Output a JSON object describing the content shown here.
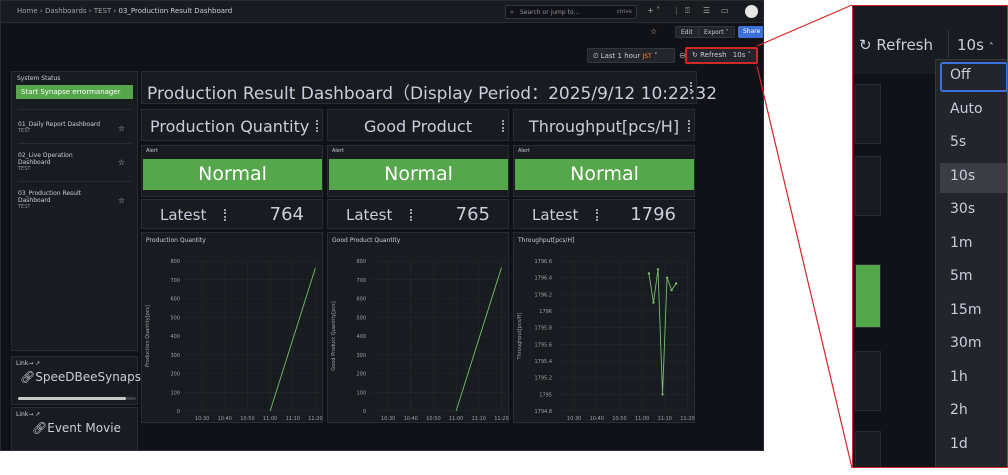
{
  "breadcrumb": {
    "home": "Home",
    "dashboards": "Dashboards",
    "folder": "TEST",
    "current": "03_Production Result Dashboard"
  },
  "search": {
    "placeholder": "Search or jump to...",
    "shortcut": "ctrl+k"
  },
  "toolbar": {
    "edit": "Edit",
    "export": "Export",
    "share": "Share"
  },
  "time_picker": {
    "label": "Last 1 hour",
    "tz": "JST"
  },
  "refresh": {
    "label": "Refresh",
    "interval": "10s"
  },
  "sidebar": {
    "title": "System Status",
    "button": "Start Synapse errormanager",
    "items": [
      {
        "name": "01_Daily Report Dashboard",
        "folder": "TEST"
      },
      {
        "name": "02_Live Operation Dashboard",
        "folder": "TEST"
      },
      {
        "name": "03_Production Result Dashboard",
        "folder": "TEST"
      }
    ]
  },
  "links": [
    {
      "title": "Link→",
      "label": "SpeeDBeeSynaps"
    },
    {
      "title": "Link→",
      "label": "Event Movie"
    }
  ],
  "main": {
    "title": "Production Result Dashboard（Display Period：2025/9/12 10:22:32",
    "columns": [
      {
        "header": "Production Quantity",
        "alert_title": "Alert",
        "alert": "Normal",
        "latest_label": "Latest",
        "latest": "764"
      },
      {
        "header": "Good Product",
        "alert_title": "Alert",
        "alert": "Normal",
        "latest_label": "Latest",
        "latest": "765"
      },
      {
        "header": "Throughput[pcs/H]",
        "alert_title": "Alert",
        "alert": "Normal",
        "latest_label": "Latest",
        "latest": "1796"
      }
    ]
  },
  "chart_data": [
    {
      "type": "line",
      "title": "Production Quantity",
      "ylabel": "Production Quantity[pcs]",
      "x": [
        "11:00",
        "11:20"
      ],
      "series": [
        {
          "values": [
            0,
            764
          ]
        }
      ],
      "ylim": [
        0,
        800
      ],
      "yticks": [
        "0",
        "100",
        "200",
        "300",
        "400",
        "500",
        "600",
        "700",
        "800"
      ],
      "xticks": [
        "10:30",
        "10:40",
        "10:50",
        "11:00",
        "11:10",
        "11:20"
      ],
      "color": "#73bf69"
    },
    {
      "type": "line",
      "title": "Good Product Quantity",
      "ylabel": "Good Product Quantity[pcs]",
      "x": [
        "11:00",
        "11:20"
      ],
      "series": [
        {
          "values": [
            0,
            765
          ]
        }
      ],
      "ylim": [
        0,
        800
      ],
      "yticks": [
        "0",
        "100",
        "200",
        "300",
        "400",
        "500",
        "600",
        "700",
        "800"
      ],
      "xticks": [
        "10:30",
        "10:40",
        "10:50",
        "11:00",
        "11:10",
        "11:20"
      ],
      "color": "#73bf69"
    },
    {
      "type": "line",
      "title": "Throughput[pcs/H]",
      "ylabel": "Throughput[pcs/H]",
      "x": [
        "11:03",
        "11:05",
        "11:07",
        "11:09",
        "11:11",
        "11:13",
        "11:15"
      ],
      "series": [
        {
          "values": [
            1796.45,
            1796.1,
            1796.5,
            1795.0,
            1796.4,
            1796.25,
            1796.33
          ]
        }
      ],
      "ylim": [
        1794.8,
        1796.6
      ],
      "yticks": [
        "1794.8",
        "1795",
        "1795.2",
        "1795.4",
        "1795.6",
        "1795.8",
        "1796",
        "1796.2",
        "1796.4",
        "1796.6"
      ],
      "xticks": [
        "10:30",
        "10:40",
        "10:50",
        "11:00",
        "11:10",
        "11:20"
      ],
      "color": "#73bf69"
    }
  ],
  "zoom": {
    "refresh_label": "Refresh",
    "interval": "10s",
    "options": [
      "Off",
      "Auto",
      "5s",
      "10s",
      "30s",
      "1m",
      "5m",
      "15m",
      "30m",
      "1h",
      "2h",
      "1d"
    ],
    "focused": "Off",
    "selected": "10s"
  },
  "colors": {
    "accent": "#3d71d9",
    "ok": "#56a64b",
    "callout": "#d22628",
    "bg": "#111217"
  }
}
